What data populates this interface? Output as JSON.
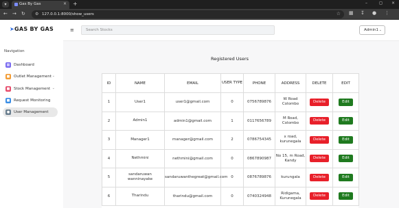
{
  "browser": {
    "tab_title": "Gas By Gas",
    "url": "127.0.0.1:8000/show_users"
  },
  "app": {
    "logo_text": "GAS BY GAS",
    "search_placeholder": "Search Stocks",
    "user_menu_label": "Admin1"
  },
  "sidebar": {
    "heading": "Navigation",
    "items": [
      {
        "label": "Dashboard",
        "icon": "dashboard-icon",
        "color": "#7b6cf0",
        "expandable": false
      },
      {
        "label": "Outlet Management",
        "icon": "store-icon",
        "color": "#f39c34",
        "expandable": true
      },
      {
        "label": "Stock Management",
        "icon": "box-icon",
        "color": "#e74c6c",
        "expandable": true
      },
      {
        "label": "Request Monitoring",
        "icon": "clipboard-icon",
        "color": "#3a8ee6",
        "expandable": false
      },
      {
        "label": "User Management",
        "icon": "users-icon",
        "color": "#6b7f8f",
        "expandable": false
      }
    ]
  },
  "main": {
    "title": "Registered Users",
    "table": {
      "columns": [
        "ID",
        "NAME",
        "EMAIL",
        "USER TYPE",
        "PHONE",
        "ADDRESS",
        "DELETE",
        "EDIT"
      ],
      "delete_label": "Delete",
      "edit_label": "Edit",
      "rows": [
        {
          "id": "1",
          "name": "User1",
          "email": "user1@gmail.com",
          "user_type": "0",
          "phone": "0756789876",
          "address": "W Road Colombo"
        },
        {
          "id": "2",
          "name": "Admin1",
          "email": "admin1@gmail.com",
          "user_type": "1",
          "phone": "0117656789",
          "address": "M Road, Colombo"
        },
        {
          "id": "3",
          "name": "Manager1",
          "email": "manager@gmail.com",
          "user_type": "2",
          "phone": "0786754345",
          "address": "x road, kurunegala"
        },
        {
          "id": "4",
          "name": "Nethmini",
          "email": "nethmini@gmail.com",
          "user_type": "0",
          "phone": "0867890987",
          "address": "No 15, m Road, Kandy"
        },
        {
          "id": "5",
          "name": "sandaruwan wanninayake",
          "email": "sandaruwanthegreat@gmail.com",
          "user_type": "0",
          "phone": "0876789876",
          "address": "kurungala"
        },
        {
          "id": "6",
          "name": "Tharindu",
          "email": "tharindu@gmail.com",
          "user_type": "0",
          "phone": "0740324948",
          "address": "Ridigama, Kurunegala"
        }
      ]
    }
  },
  "colors": {
    "delete": "#e8202a",
    "edit": "#1f7a1f",
    "accent": "#2d6cdf"
  }
}
